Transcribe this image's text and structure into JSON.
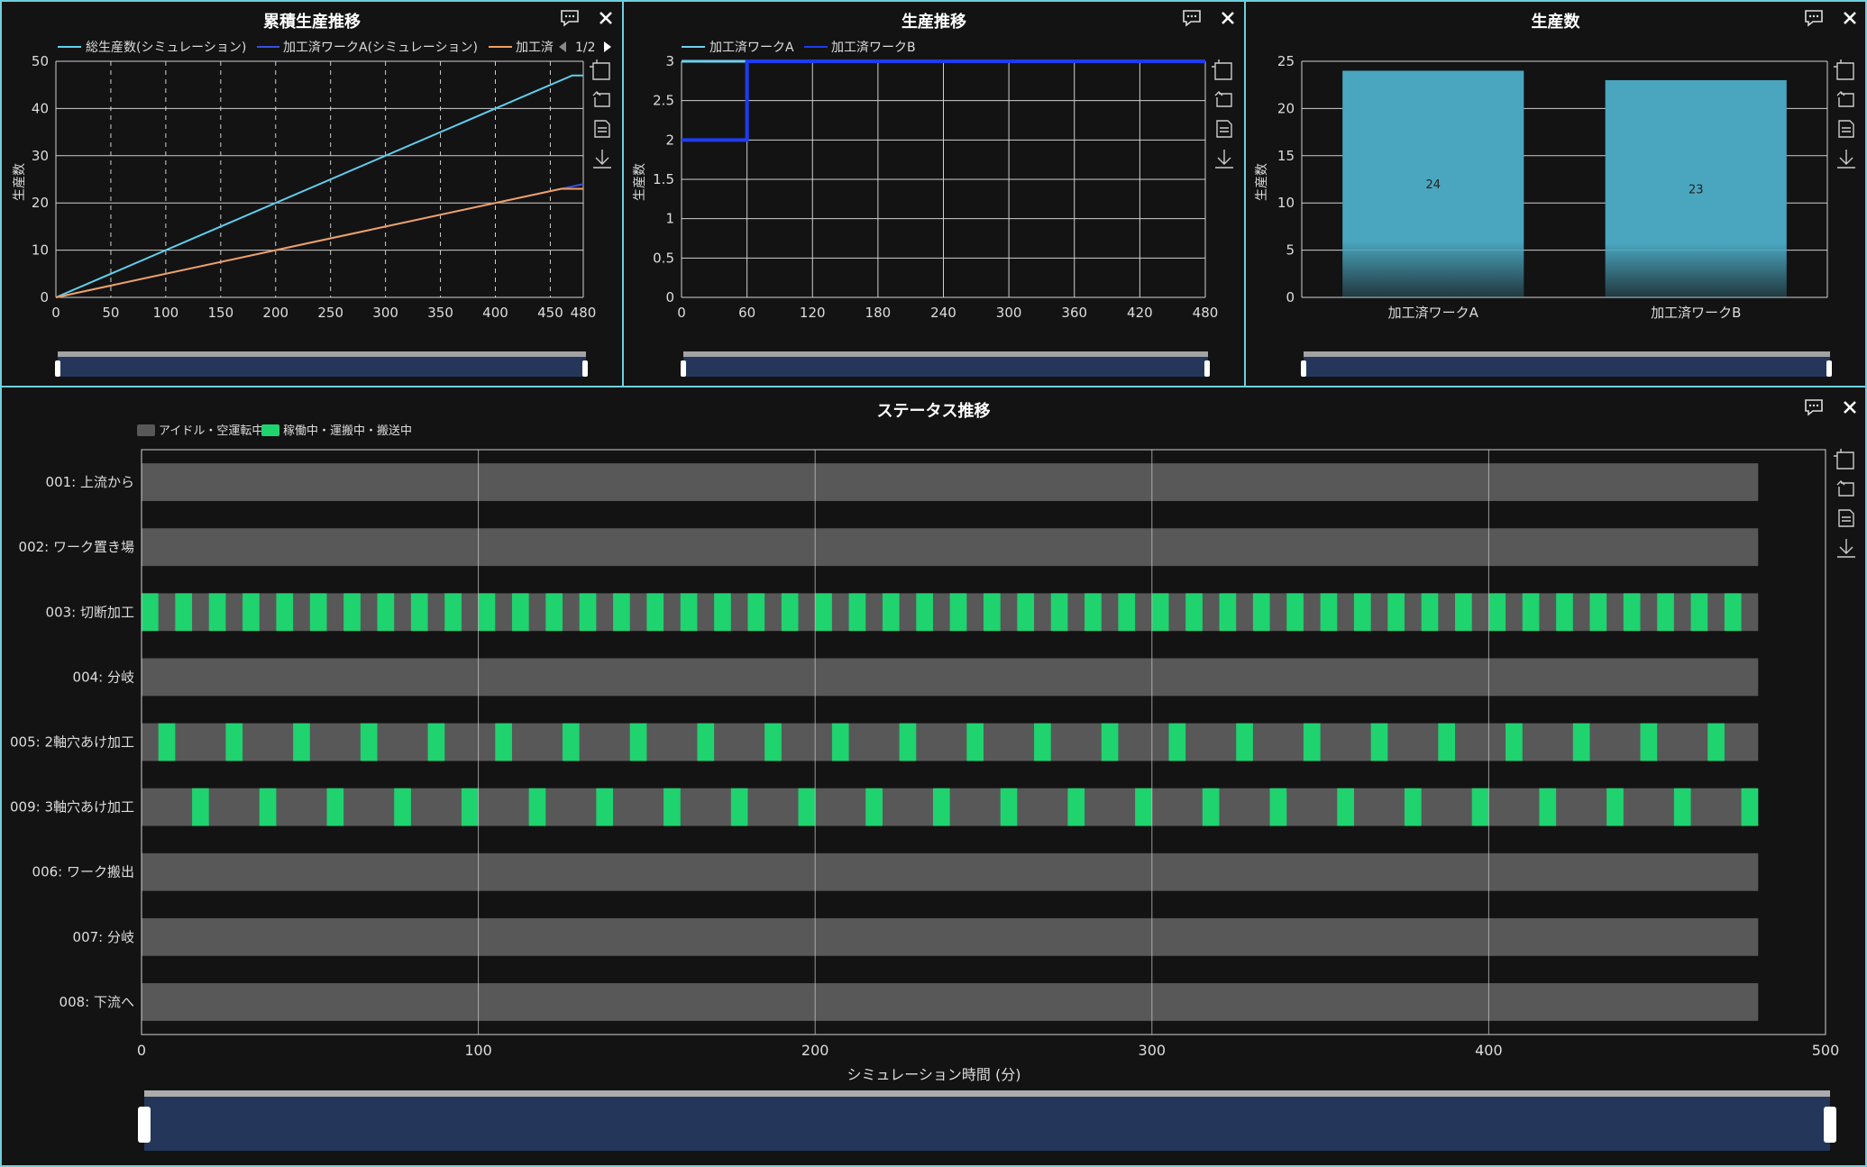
{
  "colors": {
    "background": "#131313",
    "panel_border": "#6fd0dd",
    "series_total": "#5fd0ee",
    "series_a": "#3a4fe0",
    "series_b": "#f0a060",
    "step_a": "#6fd0ee",
    "step_b": "#1e3cf0",
    "bar": "#4aa6bf",
    "idle": "#585858",
    "active": "#1fd36f",
    "scrollbar": "#24375a"
  },
  "icons": [
    "comment-icon",
    "close-icon",
    "zoom-select-icon",
    "zoom-reset-icon",
    "data-view-icon",
    "download-icon"
  ],
  "legend_pager": "1/2",
  "panels": {
    "cumulative": {
      "title": "累積生産推移",
      "chart_data": {
        "type": "line",
        "ylabel": "生産数",
        "xlim": [
          0,
          480
        ],
        "ylim": [
          0,
          50
        ],
        "xticks": [
          0,
          50,
          100,
          150,
          200,
          250,
          300,
          350,
          400,
          450,
          480
        ],
        "yticks": [
          0,
          10,
          20,
          30,
          40,
          50
        ],
        "series": [
          {
            "name": "総生産数(シミュレーション)",
            "x": [
              0,
              470,
              480
            ],
            "y": [
              0,
              47,
              47
            ]
          },
          {
            "name": "加工済ワークA(シミュレーション)",
            "x": [
              0,
              470,
              480
            ],
            "y": [
              0,
              23.5,
              24
            ]
          },
          {
            "name": "加工済",
            "x": [
              0,
              460,
              480
            ],
            "y": [
              0,
              23,
              23
            ]
          }
        ]
      }
    },
    "trend": {
      "title": "生産推移",
      "chart_data": {
        "type": "line",
        "ylabel": "生産数",
        "xlim": [
          0,
          480
        ],
        "ylim": [
          0,
          3
        ],
        "xticks": [
          0,
          60,
          120,
          180,
          240,
          300,
          360,
          420,
          480
        ],
        "yticks": [
          "0",
          "0.5",
          "1",
          "1.5",
          "2",
          "2.5",
          "3"
        ],
        "series": [
          {
            "name": "加工済ワークA",
            "x": [
              0,
              480
            ],
            "y": [
              3,
              3
            ]
          },
          {
            "name": "加工済ワークB",
            "x": [
              0,
              60,
              60,
              480
            ],
            "y": [
              2,
              2,
              3,
              3
            ]
          }
        ]
      }
    },
    "count": {
      "title": "生産数",
      "chart_data": {
        "type": "bar",
        "ylabel": "生産数",
        "ylim": [
          0,
          25
        ],
        "yticks": [
          0,
          5,
          10,
          15,
          20,
          25
        ],
        "categories": [
          "加工済ワークA",
          "加工済ワークB"
        ],
        "values": [
          24,
          23
        ],
        "data_labels": [
          "24",
          "23"
        ]
      }
    },
    "status": {
      "title": "ステータス推移",
      "legend": [
        "アイドル・空運転中",
        "稼働中・運搬中・搬送中"
      ],
      "chart_data": {
        "type": "bar",
        "xlabel": "シミュレーション時間 (分)",
        "xlim": [
          0,
          500
        ],
        "xticks": [
          0,
          100,
          200,
          300,
          400,
          500
        ],
        "rows": [
          {
            "label": "001: 上流から",
            "pattern": "idle"
          },
          {
            "label": "002: ワーク置き場",
            "pattern": "idle"
          },
          {
            "label": "003: 切断加工",
            "pattern": "periodic",
            "period": 10,
            "duration": 5,
            "offset": 0
          },
          {
            "label": "004: 分岐",
            "pattern": "idle"
          },
          {
            "label": "005: 2軸穴あけ加工",
            "pattern": "periodic",
            "period": 20,
            "duration": 5,
            "offset": 5
          },
          {
            "label": "009: 3軸穴あけ加工",
            "pattern": "periodic",
            "period": 20,
            "duration": 5,
            "offset": 15
          },
          {
            "label": "006: ワーク搬出",
            "pattern": "idle"
          },
          {
            "label": "007: 分岐",
            "pattern": "idle"
          },
          {
            "label": "008: 下流へ",
            "pattern": "idle"
          }
        ],
        "end": 480
      }
    }
  }
}
